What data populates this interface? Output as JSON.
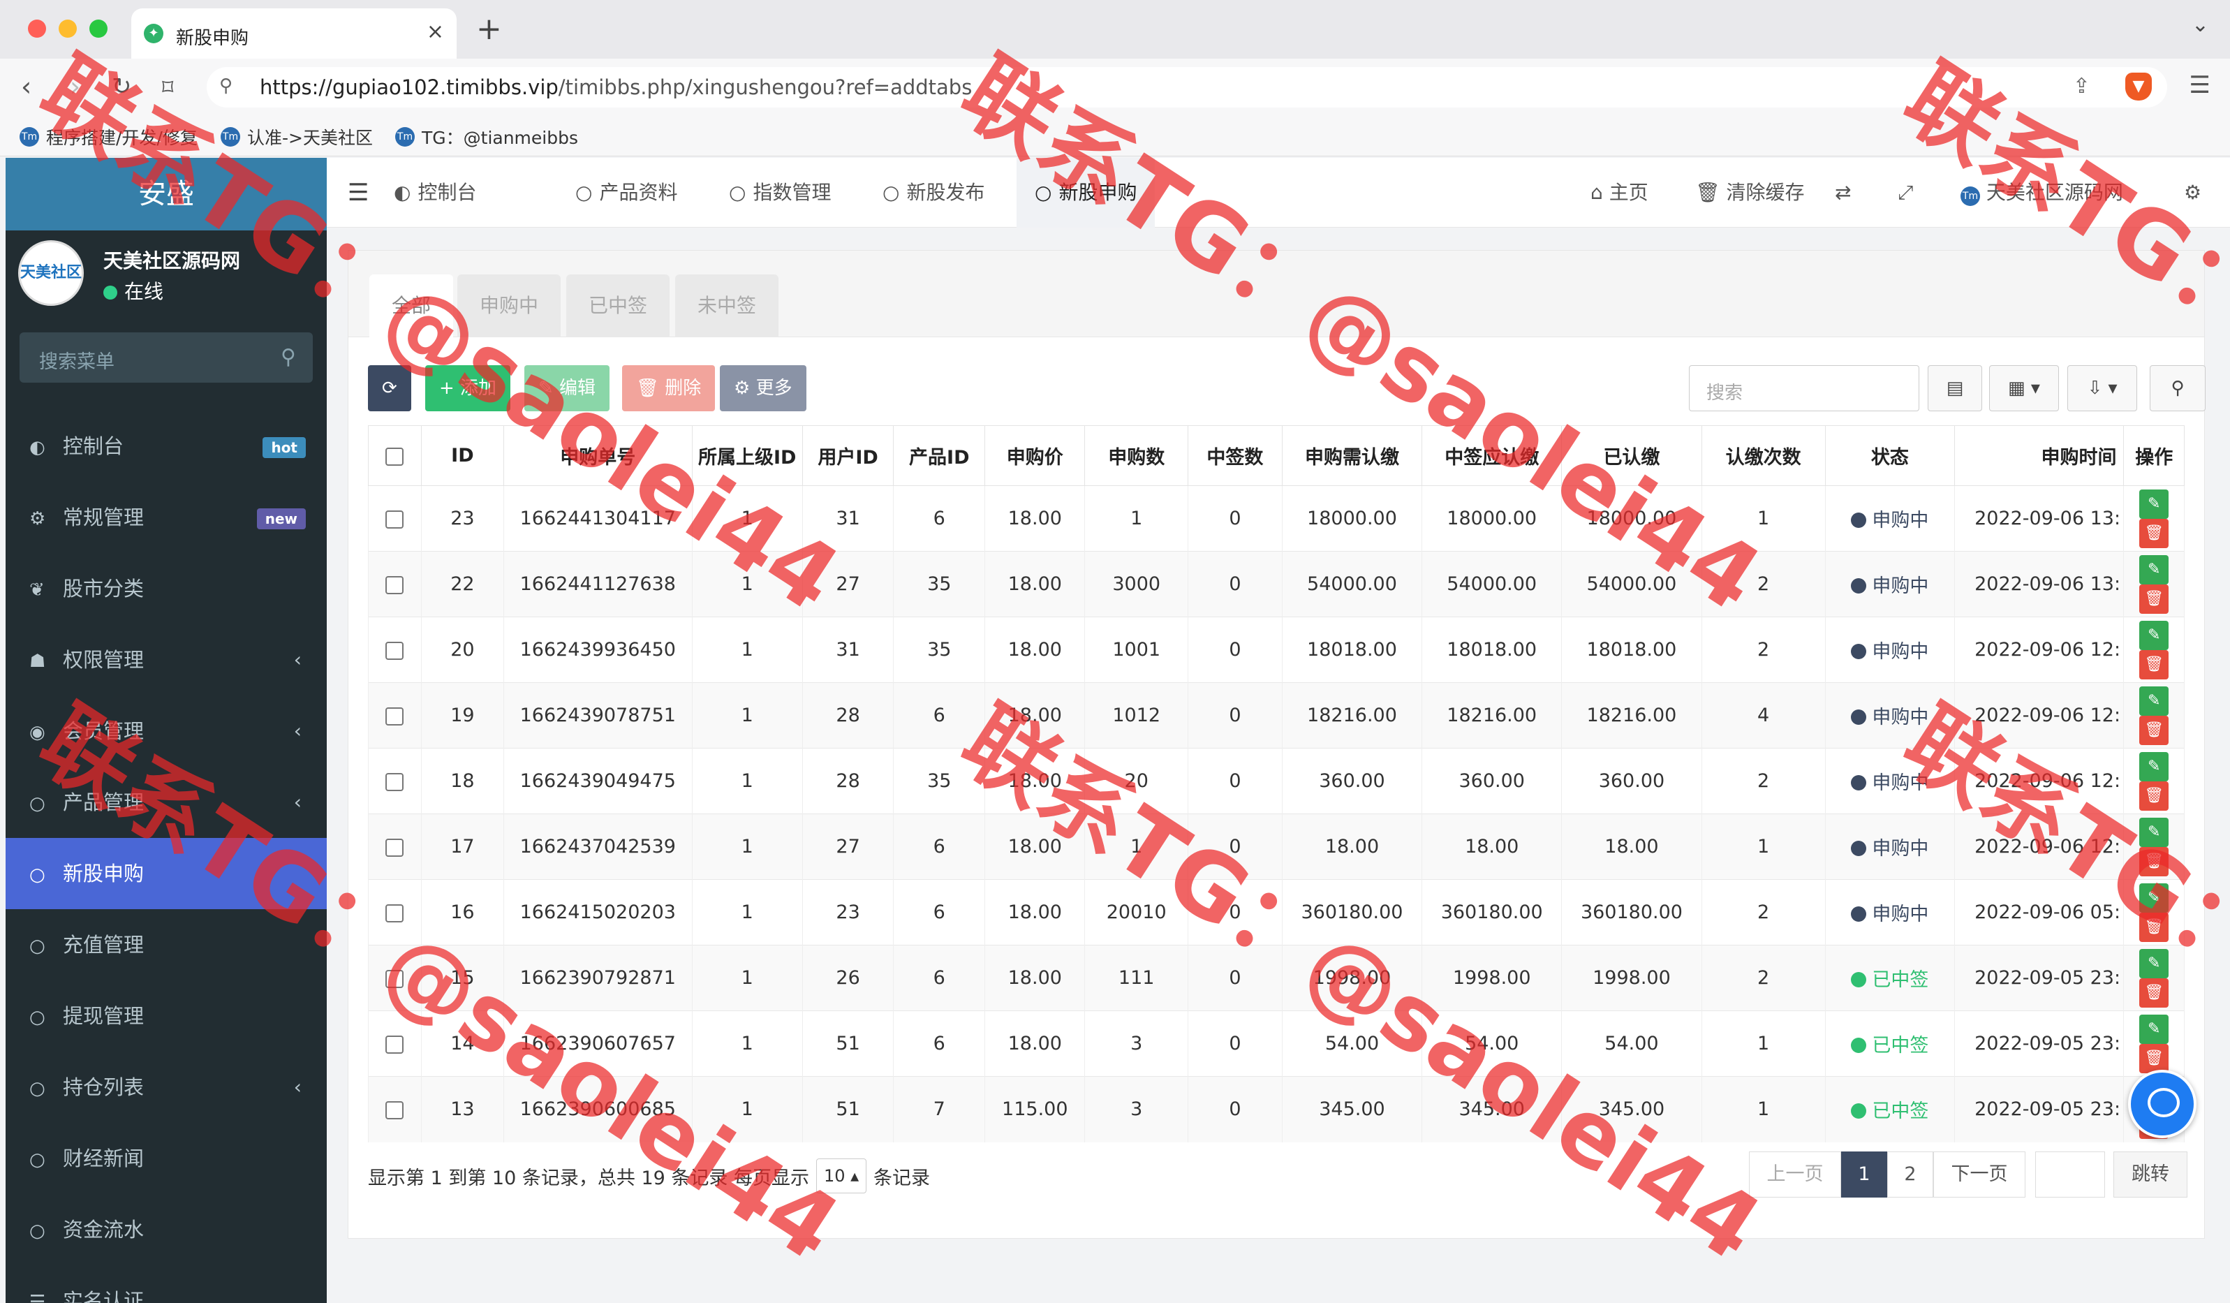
{
  "browser": {
    "tab_title": "新股申购",
    "tab_close": "×",
    "new_tab": "+",
    "tab_menu": "⌄",
    "url_host": "https://gupiao102.timibbs.vip",
    "url_path": "/timibbs.php/xingushengou?ref=addtabs",
    "bookmarks": [
      "程序搭建/开发/修复",
      "认准->天美社区",
      "TG：@tianmeibbs"
    ]
  },
  "sidebar": {
    "brand": "安盛",
    "avatar_text": "天美社区",
    "user_name": "天美社区源码网",
    "user_status": "在线",
    "search_placeholder": "搜索菜单",
    "items": [
      {
        "label": "控制台",
        "icon": "dashboard-icon",
        "glyph": "◐",
        "badge": "hot",
        "badge_color": "#3c8dbc"
      },
      {
        "label": "常规管理",
        "icon": "cogs-icon",
        "glyph": "⚙",
        "badge": "new",
        "badge_color": "#605ca8"
      },
      {
        "label": "股市分类",
        "icon": "leaf-icon",
        "glyph": "❦"
      },
      {
        "label": "权限管理",
        "icon": "group-icon",
        "glyph": "☗",
        "arrow": "‹"
      },
      {
        "label": "会员管理",
        "icon": "user-circle-icon",
        "glyph": "◉",
        "arrow": "‹"
      },
      {
        "label": "产品管理",
        "icon": "circle-icon",
        "glyph": "○",
        "arrow": "‹"
      },
      {
        "label": "新股申购",
        "icon": "circle-icon",
        "glyph": "○",
        "active": true
      },
      {
        "label": "充值管理",
        "icon": "circle-icon",
        "glyph": "○"
      },
      {
        "label": "提现管理",
        "icon": "circle-icon",
        "glyph": "○"
      },
      {
        "label": "持仓列表",
        "icon": "circle-icon",
        "glyph": "○",
        "arrow": "‹"
      },
      {
        "label": "财经新闻",
        "icon": "circle-icon",
        "glyph": "○"
      },
      {
        "label": "资金流水",
        "icon": "circle-icon",
        "glyph": "○"
      },
      {
        "label": "实名认证",
        "icon": "list-icon",
        "glyph": "☰"
      }
    ]
  },
  "topnav": {
    "tabs": [
      {
        "label": "控制台",
        "glyph": "◐"
      },
      {
        "label": "产品资料",
        "glyph": "○"
      },
      {
        "label": "指数管理",
        "glyph": "○"
      },
      {
        "label": "新股发布",
        "glyph": "○"
      },
      {
        "label": "新股申购",
        "glyph": "○",
        "active": true
      }
    ],
    "home": "主页",
    "clear_cache": "清除缓存",
    "site_name": "天美社区源码网"
  },
  "filters": [
    "全部",
    "申购中",
    "已中签",
    "未中签"
  ],
  "toolbar": {
    "refresh": "⟳",
    "add": "+ 添加",
    "edit": "✎ 编辑",
    "delete": "🗑 删除",
    "more": "⚙ 更多",
    "search_placeholder": "搜索"
  },
  "table": {
    "headers": [
      "ID",
      "申购单号",
      "所属上级ID",
      "用户ID",
      "产品ID",
      "申购价",
      "申购数",
      "中签数",
      "申购需认缴",
      "中签应认缴",
      "已认缴",
      "认缴次数",
      "状态",
      "申购时间",
      "操作"
    ],
    "rows": [
      {
        "id": "23",
        "order": "1662441304117",
        "parent": "1",
        "uid": "31",
        "pid": "6",
        "price": "18.00",
        "qty": "1",
        "won": "0",
        "need": "18000.00",
        "should": "18000.00",
        "paid": "18000.00",
        "times": "1",
        "status": "申购中",
        "time": "2022-09-06 13:"
      },
      {
        "id": "22",
        "order": "1662441127638",
        "parent": "1",
        "uid": "27",
        "pid": "35",
        "price": "18.00",
        "qty": "3000",
        "won": "0",
        "need": "54000.00",
        "should": "54000.00",
        "paid": "54000.00",
        "times": "2",
        "status": "申购中",
        "time": "2022-09-06 13:"
      },
      {
        "id": "20",
        "order": "1662439936450",
        "parent": "1",
        "uid": "31",
        "pid": "35",
        "price": "18.00",
        "qty": "1001",
        "won": "0",
        "need": "18018.00",
        "should": "18018.00",
        "paid": "18018.00",
        "times": "2",
        "status": "申购中",
        "time": "2022-09-06 12:"
      },
      {
        "id": "19",
        "order": "1662439078751",
        "parent": "1",
        "uid": "28",
        "pid": "6",
        "price": "18.00",
        "qty": "1012",
        "won": "0",
        "need": "18216.00",
        "should": "18216.00",
        "paid": "18216.00",
        "times": "4",
        "status": "申购中",
        "time": "2022-09-06 12:"
      },
      {
        "id": "18",
        "order": "1662439049475",
        "parent": "1",
        "uid": "28",
        "pid": "35",
        "price": "18.00",
        "qty": "20",
        "won": "0",
        "need": "360.00",
        "should": "360.00",
        "paid": "360.00",
        "times": "2",
        "status": "申购中",
        "time": "2022-09-06 12:"
      },
      {
        "id": "17",
        "order": "1662437042539",
        "parent": "1",
        "uid": "27",
        "pid": "6",
        "price": "18.00",
        "qty": "1",
        "won": "0",
        "need": "18.00",
        "should": "18.00",
        "paid": "18.00",
        "times": "1",
        "status": "申购中",
        "time": "2022-09-06 12:"
      },
      {
        "id": "16",
        "order": "1662415020203",
        "parent": "1",
        "uid": "23",
        "pid": "6",
        "price": "18.00",
        "qty": "20010",
        "won": "0",
        "need": "360180.00",
        "should": "360180.00",
        "paid": "360180.00",
        "times": "2",
        "status": "申购中",
        "time": "2022-09-06 05:"
      },
      {
        "id": "15",
        "order": "1662390792871",
        "parent": "1",
        "uid": "26",
        "pid": "6",
        "price": "18.00",
        "qty": "111",
        "won": "0",
        "need": "1998.00",
        "should": "1998.00",
        "paid": "1998.00",
        "times": "2",
        "status": "已中签",
        "time": "2022-09-05 23:"
      },
      {
        "id": "14",
        "order": "1662390607657",
        "parent": "1",
        "uid": "51",
        "pid": "6",
        "price": "18.00",
        "qty": "3",
        "won": "0",
        "need": "54.00",
        "should": "54.00",
        "paid": "54.00",
        "times": "1",
        "status": "已中签",
        "time": "2022-09-05 23:"
      },
      {
        "id": "13",
        "order": "1662390600685",
        "parent": "1",
        "uid": "51",
        "pid": "7",
        "price": "115.00",
        "qty": "3",
        "won": "0",
        "need": "345.00",
        "should": "345.00",
        "paid": "345.00",
        "times": "1",
        "status": "已中签",
        "time": "2022-09-05 23:"
      }
    ]
  },
  "pagination": {
    "info_prefix": "显示第 1 到第 10 条记录，总共 19 条记录 每页显示",
    "page_size": "10",
    "info_suffix": "条记录",
    "prev": "上一页",
    "pages": [
      "1",
      "2"
    ],
    "next": "下一页",
    "jump": "跳转"
  },
  "watermark": "联系TG：@saolei44",
  "colors": {
    "accent": "#4a67d6",
    "sidebar": "#222d32",
    "success": "#2fbf71",
    "danger": "#e74c3c",
    "primary_dark": "#3c4a62"
  }
}
